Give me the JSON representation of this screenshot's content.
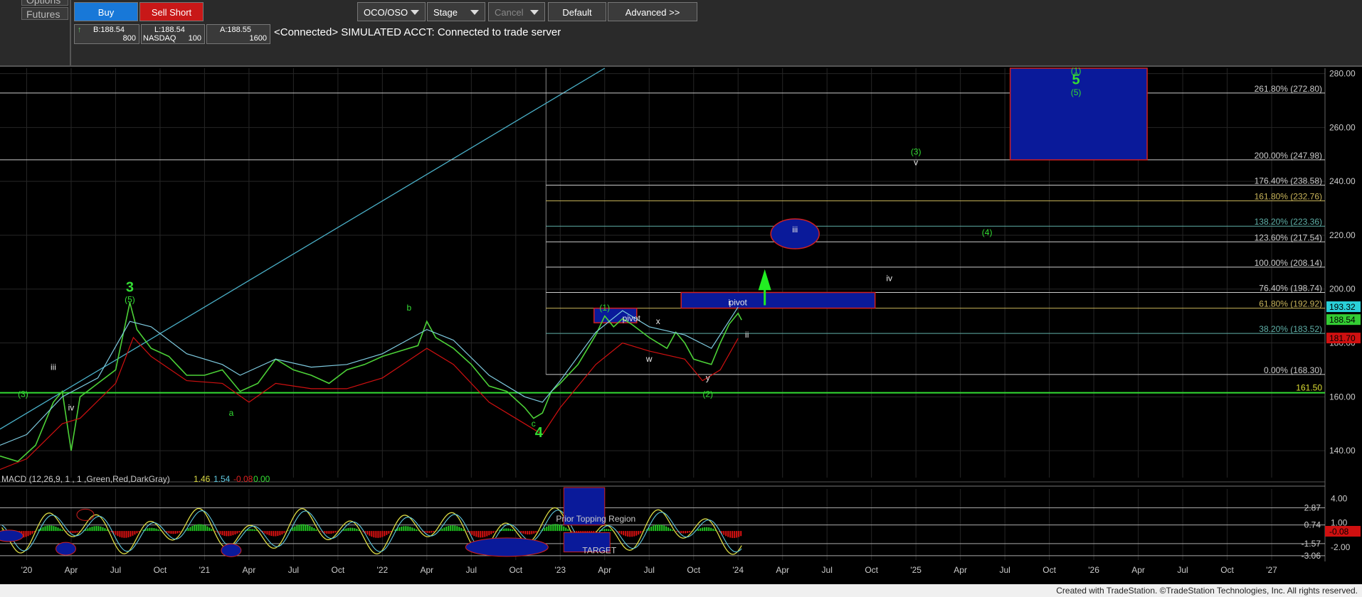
{
  "toolbar": {
    "left_tabs": [
      "Options",
      "Futures"
    ],
    "buy": "Buy",
    "sell_short": "Sell Short",
    "oco": "OCO/OSO",
    "stage": "Stage",
    "cancel": "Cancel",
    "default": "Default",
    "advanced": "Advanced >>",
    "bid": "B:188.54",
    "bid_size": "800",
    "last": "L:188.54",
    "last_exchange": "NASDAQ",
    "last_size": "100",
    "ask": "A:188.55",
    "ask_size": "1600",
    "status": "<Connected> SIMULATED ACCT: Connected to trade server"
  },
  "footer": "Created with TradeStation. ©TradeStation Technologies, Inc. All rights reserved.",
  "colors": {
    "price": "#4cd137",
    "bb_upper": "#7ecbe0",
    "bb_lower": "#d01010",
    "green": "#33dd33",
    "blue_box": "#0a1a9a",
    "grid": "#2a2a2a"
  },
  "chart_data": {
    "type": "line",
    "price_axis": {
      "ticks": [
        140,
        160,
        180,
        200,
        220,
        240,
        260,
        280
      ],
      "range": [
        130,
        282
      ]
    },
    "x_tick_labels": [
      "'20",
      "Apr",
      "Jul",
      "Oct",
      "'21",
      "Apr",
      "Jul",
      "Oct",
      "'22",
      "Apr",
      "Jul",
      "Oct",
      "'23",
      "Apr",
      "Jul",
      "Oct",
      "'24",
      "Apr",
      "Jul",
      "Oct",
      "'25",
      "Apr",
      "Jul",
      "Oct",
      "'26",
      "Apr",
      "Jul",
      "Oct",
      "'27"
    ],
    "series": [
      {
        "values": [
          [
            2019.85,
            138
          ],
          [
            2019.95,
            136
          ],
          [
            2020.05,
            142
          ],
          [
            2020.15,
            158
          ],
          [
            2020.2,
            162
          ],
          [
            2020.25,
            140
          ],
          [
            2020.3,
            160
          ],
          [
            2020.4,
            165
          ],
          [
            2020.5,
            170
          ],
          [
            2020.58,
            195
          ],
          [
            2020.62,
            185
          ],
          [
            2020.7,
            178
          ],
          [
            2020.8,
            175
          ],
          [
            2020.9,
            168
          ],
          [
            2021.0,
            168
          ],
          [
            2021.1,
            170
          ],
          [
            2021.2,
            162
          ],
          [
            2021.3,
            165
          ],
          [
            2021.4,
            174
          ],
          [
            2021.5,
            170
          ],
          [
            2021.6,
            168
          ],
          [
            2021.7,
            165
          ],
          [
            2021.8,
            170
          ],
          [
            2021.9,
            172
          ],
          [
            2022.0,
            175
          ],
          [
            2022.1,
            177
          ],
          [
            2022.2,
            179
          ],
          [
            2022.25,
            188
          ],
          [
            2022.3,
            182
          ],
          [
            2022.4,
            178
          ],
          [
            2022.5,
            172
          ],
          [
            2022.6,
            164
          ],
          [
            2022.7,
            162
          ],
          [
            2022.8,
            156
          ],
          [
            2022.85,
            152
          ],
          [
            2022.9,
            154
          ],
          [
            2022.95,
            162
          ],
          [
            2023.0,
            165
          ],
          [
            2023.1,
            172
          ],
          [
            2023.2,
            183
          ],
          [
            2023.25,
            190
          ],
          [
            2023.3,
            186
          ],
          [
            2023.35,
            189
          ],
          [
            2023.4,
            187
          ],
          [
            2023.5,
            182
          ],
          [
            2023.6,
            178
          ],
          [
            2023.65,
            184
          ],
          [
            2023.7,
            180
          ],
          [
            2023.75,
            174
          ],
          [
            2023.8,
            173
          ],
          [
            2023.85,
            172
          ],
          [
            2023.9,
            180
          ],
          [
            2023.95,
            187
          ],
          [
            2024.0,
            191
          ],
          [
            2024.02,
            188.54
          ]
        ]
      },
      {
        "values": [
          [
            2019.85,
            142
          ],
          [
            2020.0,
            146
          ],
          [
            2020.2,
            160
          ],
          [
            2020.4,
            167
          ],
          [
            2020.58,
            188
          ],
          [
            2020.7,
            186
          ],
          [
            2020.9,
            176
          ],
          [
            2021.1,
            172
          ],
          [
            2021.2,
            168
          ],
          [
            2021.4,
            174
          ],
          [
            2021.6,
            171
          ],
          [
            2021.8,
            172
          ],
          [
            2022.0,
            176
          ],
          [
            2022.25,
            185
          ],
          [
            2022.4,
            181
          ],
          [
            2022.6,
            168
          ],
          [
            2022.8,
            160
          ],
          [
            2022.9,
            158
          ],
          [
            2023.0,
            166
          ],
          [
            2023.2,
            184
          ],
          [
            2023.35,
            192
          ],
          [
            2023.5,
            186
          ],
          [
            2023.7,
            183
          ],
          [
            2023.85,
            178
          ],
          [
            2024.0,
            193.32
          ]
        ]
      },
      {
        "values": [
          [
            2019.85,
            133
          ],
          [
            2020.0,
            137
          ],
          [
            2020.2,
            150
          ],
          [
            2020.3,
            152
          ],
          [
            2020.5,
            165
          ],
          [
            2020.6,
            182
          ],
          [
            2020.7,
            175
          ],
          [
            2020.9,
            166
          ],
          [
            2021.1,
            165
          ],
          [
            2021.25,
            158
          ],
          [
            2021.4,
            165
          ],
          [
            2021.6,
            163
          ],
          [
            2021.8,
            163
          ],
          [
            2022.0,
            167
          ],
          [
            2022.25,
            178
          ],
          [
            2022.4,
            172
          ],
          [
            2022.6,
            158
          ],
          [
            2022.8,
            150
          ],
          [
            2022.9,
            146
          ],
          [
            2023.0,
            156
          ],
          [
            2023.2,
            172
          ],
          [
            2023.35,
            180
          ],
          [
            2023.5,
            177
          ],
          [
            2023.7,
            174
          ],
          [
            2023.8,
            166
          ],
          [
            2023.9,
            170
          ],
          [
            2024.0,
            181.7
          ]
        ]
      }
    ],
    "fib_levels": [
      {
        "label": "261.80% (272.80)",
        "value": 272.8
      },
      {
        "label": "200.00% (247.98)",
        "value": 247.98
      },
      {
        "label": "176.40% (238.58)",
        "value": 238.58
      },
      {
        "label": "161.80% (232.76)",
        "value": 232.76
      },
      {
        "label": "138.20% (223.36)",
        "value": 223.36
      },
      {
        "label": "123.60% (217.54)",
        "value": 217.54
      },
      {
        "label": "100.00% (208.14)",
        "value": 208.14
      },
      {
        "label": "76.40% (198.74)",
        "value": 198.74
      },
      {
        "label": "61.80% (192.92)",
        "value": 192.92
      },
      {
        "label": "38.20% (183.52)",
        "value": 183.52
      },
      {
        "label": "0.00% (168.30)",
        "value": 168.3
      }
    ],
    "support_level": {
      "label": "161.50",
      "value": 161.5
    },
    "price_tags": [
      {
        "label": "193.32",
        "value": 193.32,
        "color": "#2ad0d8"
      },
      {
        "label": "188.54",
        "value": 188.54,
        "color": "#33cc33"
      },
      {
        "label": "181.70",
        "value": 181.7,
        "color": "#d01010"
      }
    ],
    "wave_labels": [
      {
        "t": "3",
        "x": 2020.58,
        "y": 199
      },
      {
        "t": "(5)",
        "x": 2020.58,
        "y": 195
      },
      {
        "t": "iii",
        "x": 2020.15,
        "y": 170
      },
      {
        "t": "(3)",
        "x": 2019.98,
        "y": 160
      },
      {
        "t": "iv",
        "x": 2020.25,
        "y": 155
      },
      {
        "t": "a",
        "x": 2021.15,
        "y": 153
      },
      {
        "t": "b",
        "x": 2022.15,
        "y": 192
      },
      {
        "t": "c",
        "x": 2022.85,
        "y": 149
      },
      {
        "t": "4",
        "x": 2022.88,
        "y": 145
      },
      {
        "t": "(1)",
        "x": 2023.25,
        "y": 192
      },
      {
        "t": "pivot",
        "x": 2023.4,
        "y": 188
      },
      {
        "t": "x",
        "x": 2023.55,
        "y": 187
      },
      {
        "t": "w",
        "x": 2023.5,
        "y": 173
      },
      {
        "t": "y",
        "x": 2023.83,
        "y": 166
      },
      {
        "t": "(2)",
        "x": 2023.83,
        "y": 160
      },
      {
        "t": "i",
        "x": 2023.95,
        "y": 194
      },
      {
        "t": "pivot",
        "x": 2024.0,
        "y": 194
      },
      {
        "t": "ii",
        "x": 2024.05,
        "y": 182
      },
      {
        "t": "iii",
        "x": 2024.32,
        "y": 221
      },
      {
        "t": "iv",
        "x": 2024.85,
        "y": 203
      },
      {
        "t": "(3)",
        "x": 2025.0,
        "y": 250
      },
      {
        "t": "v",
        "x": 2025.0,
        "y": 246
      },
      {
        "t": "(4)",
        "x": 2025.4,
        "y": 220
      },
      {
        "t": "(1)",
        "x": 2025.9,
        "y": 280
      },
      {
        "t": "5",
        "x": 2025.9,
        "y": 276
      },
      {
        "t": "(5)",
        "x": 2025.9,
        "y": 272
      }
    ],
    "macd": {
      "label": "MACD (12,26,9, 1 , 1 ,Green,Red,DarkGray)",
      "values": [
        "1.46",
        "1.54",
        "-0.08",
        "0.00"
      ],
      "axis_ticks": [
        "4.00",
        "1.00",
        "-2.00"
      ],
      "levels": [
        "2.87",
        "0.74",
        "-1.57",
        "-3.06"
      ],
      "current_tag": "-0.08",
      "annotations": [
        "Prior Topping Region",
        "TARGET"
      ]
    }
  }
}
